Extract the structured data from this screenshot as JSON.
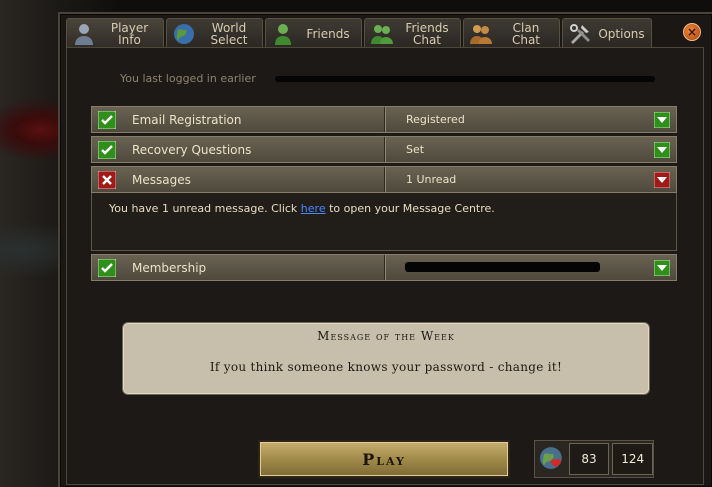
{
  "tabs": [
    {
      "label": "Player\nInfo",
      "icon": "player-icon",
      "active": true
    },
    {
      "label": "World\nSelect",
      "icon": "globe-icon"
    },
    {
      "label": "Friends",
      "icon": "friends-icon"
    },
    {
      "label": "Friends\nChat",
      "icon": "friends-chat-icon"
    },
    {
      "label": "Clan\nChat",
      "icon": "clan-chat-icon"
    },
    {
      "label": "Options",
      "icon": "tools-icon"
    }
  ],
  "close_label": "×",
  "last_login": "You last logged in earlier",
  "rows": {
    "email": {
      "label": "Email Registration",
      "value": "Registered",
      "status": "ok"
    },
    "recovery": {
      "label": "Recovery Questions",
      "value": "Set",
      "status": "ok"
    },
    "messages": {
      "label": "Messages",
      "value": "1 Unread",
      "status": "error"
    },
    "membership": {
      "label": "Membership",
      "value": "",
      "status": "ok"
    }
  },
  "messages_detail": {
    "before": "You have 1 unread message. Click ",
    "link": "here",
    "after": " to open your Message Centre."
  },
  "motw": {
    "title": "Message of the Week",
    "text": "If you think someone knows your password - change it!"
  },
  "play_label": "Play",
  "counts": {
    "first": "83",
    "second": "124"
  },
  "colors": {
    "ok": "#2f8f1a",
    "error": "#a11a1a",
    "link": "#4c86ff",
    "accent": "#c7ae6e"
  }
}
